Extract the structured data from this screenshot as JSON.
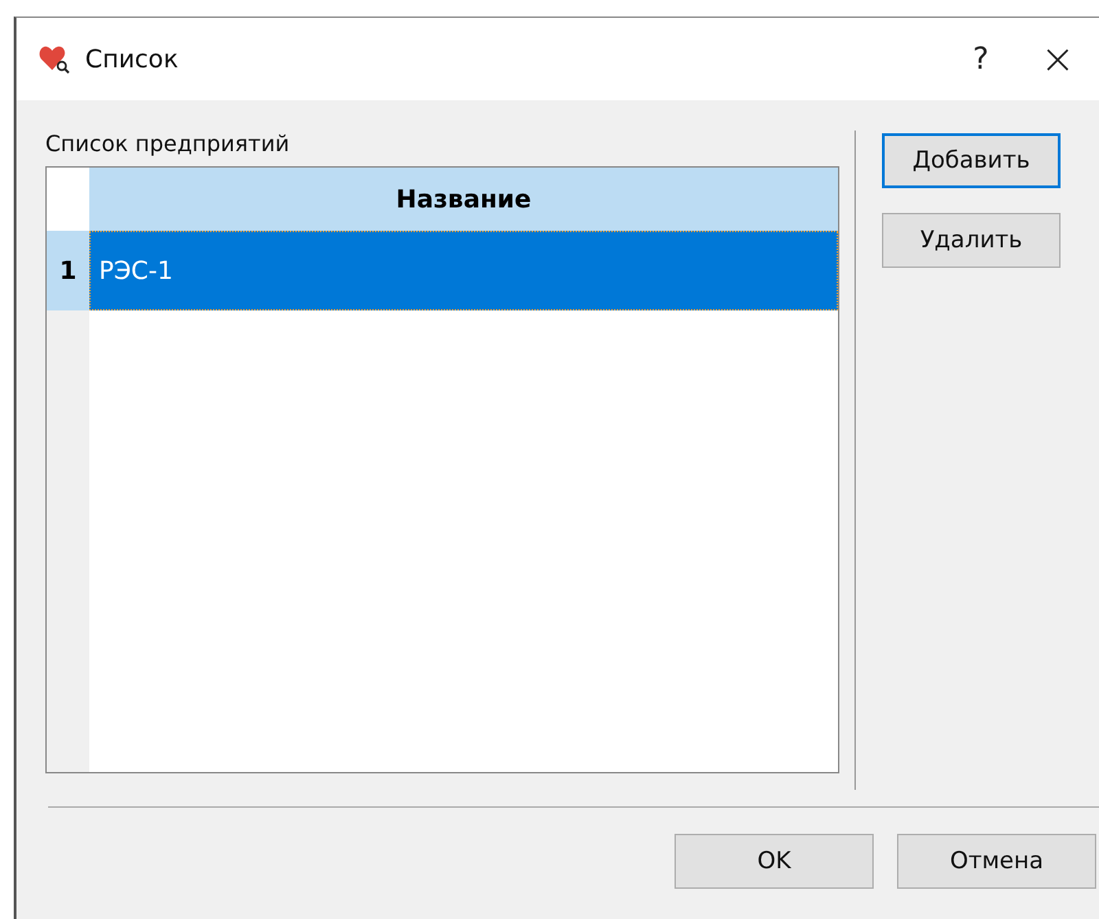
{
  "window": {
    "title": "Список",
    "help": "?",
    "close": "×"
  },
  "list_label": "Список предприятий",
  "table": {
    "columns": [
      "Название"
    ],
    "rows": [
      {
        "number": "1",
        "cells": [
          "РЭС-1"
        ],
        "selected": true
      }
    ]
  },
  "side_buttons": [
    {
      "label": "Добавить",
      "focused": true
    },
    {
      "label": "Удалить",
      "focused": false
    }
  ],
  "footer_buttons": [
    {
      "label": "OK",
      "focused": false
    },
    {
      "label": "Отмена",
      "focused": false
    }
  ]
}
